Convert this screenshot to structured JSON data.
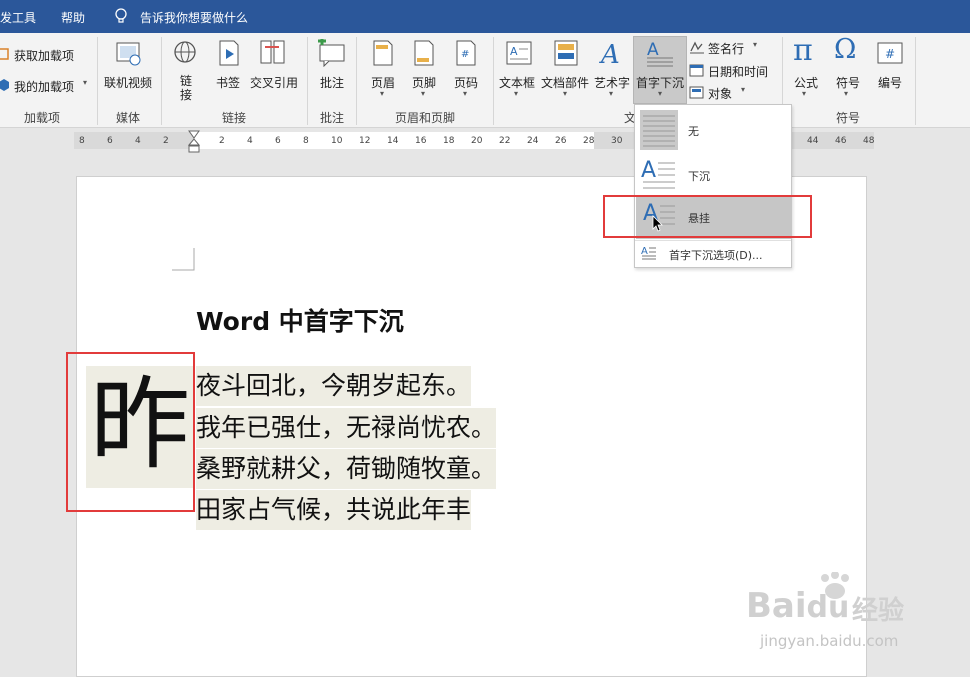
{
  "tabs": {
    "developer": "发工具",
    "help": "帮助",
    "tell_me": "告诉我你想要做什么"
  },
  "ribbon": {
    "addins": {
      "get": "获取加载项",
      "mine": "我的加载项",
      "group": "加载项"
    },
    "media": {
      "online_video": "联机视频",
      "group": "媒体"
    },
    "links": {
      "link": "链接",
      "bookmark": "书签",
      "cross_ref": "交叉引用",
      "group": "链接"
    },
    "comments": {
      "comment": "批注",
      "group": "批注"
    },
    "header_footer": {
      "header": "页眉",
      "footer": "页脚",
      "page_number": "页码",
      "group": "页眉和页脚"
    },
    "text": {
      "textbox": "文本框",
      "quick_parts": "文档部件",
      "wordart": "艺术字",
      "dropcap": "首字下沉",
      "signature": "签名行",
      "datetime": "日期和时间",
      "object": "对象",
      "group_partial": "文"
    },
    "symbols": {
      "equation": "公式",
      "symbol": "符号",
      "number": "编号",
      "group": "符号",
      "pi_glyph": "π",
      "omega_glyph": "Ω"
    }
  },
  "ruler": {
    "ticks": [
      "8",
      "6",
      "4",
      "2",
      "2",
      "4",
      "6",
      "8",
      "10",
      "12",
      "14",
      "16",
      "18",
      "20",
      "22",
      "24",
      "26",
      "28",
      "30",
      "44",
      "46",
      "48"
    ]
  },
  "dropcap_menu": {
    "none": "无",
    "dropped": "下沉",
    "in_margin": "悬挂",
    "options": "首字下沉选项(D)..."
  },
  "document": {
    "heading": "Word 中首字下沉",
    "drop_char": "昨",
    "lines": [
      "夜斗回北，今朝岁起东。",
      "我年已强仕，无禄尚忧农。",
      "桑野就耕父，荷锄随牧童。",
      "田家占气候，共说此年丰"
    ]
  },
  "watermark": {
    "brand": "Bai",
    "brand2": "du",
    "jingyan": "经验",
    "url": "jingyan.baidu.com"
  },
  "colors": {
    "titlebar": "#2b579a",
    "highlight": "#e23b3b",
    "icon_blue": "#2e6db4"
  }
}
